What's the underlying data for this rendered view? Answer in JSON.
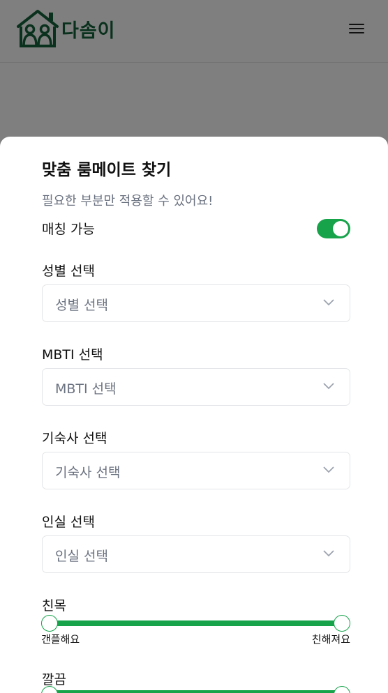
{
  "brand": {
    "name": "다솜이",
    "logo_icon": "house-people-icon"
  },
  "header": {
    "menu_icon": "hamburger-menu-icon"
  },
  "sheet": {
    "title": "맞춤 룸메이트 찾기",
    "subtitle": "필요한 부분만 적용할 수 있어요!",
    "match_toggle": {
      "label": "매칭 가능",
      "on": true
    }
  },
  "filters": [
    {
      "label": "성별 선택",
      "value": "성별 선택"
    },
    {
      "label": "MBTI 선택",
      "value": "MBTI 선택"
    },
    {
      "label": "기숙사 선택",
      "value": "기숙사 선택"
    },
    {
      "label": "인실 선택",
      "value": "인실 선택"
    }
  ],
  "sliders": [
    {
      "label": "친목",
      "min_label": "갠플해요",
      "max_label": "친해져요",
      "range": [
        0,
        1
      ]
    },
    {
      "label": "깔끔",
      "range": [
        0,
        1
      ]
    }
  ],
  "colors": {
    "accent": "#16a34a",
    "brand": "#14623a",
    "muted": "#6b7280",
    "border": "#e3e5e8"
  }
}
